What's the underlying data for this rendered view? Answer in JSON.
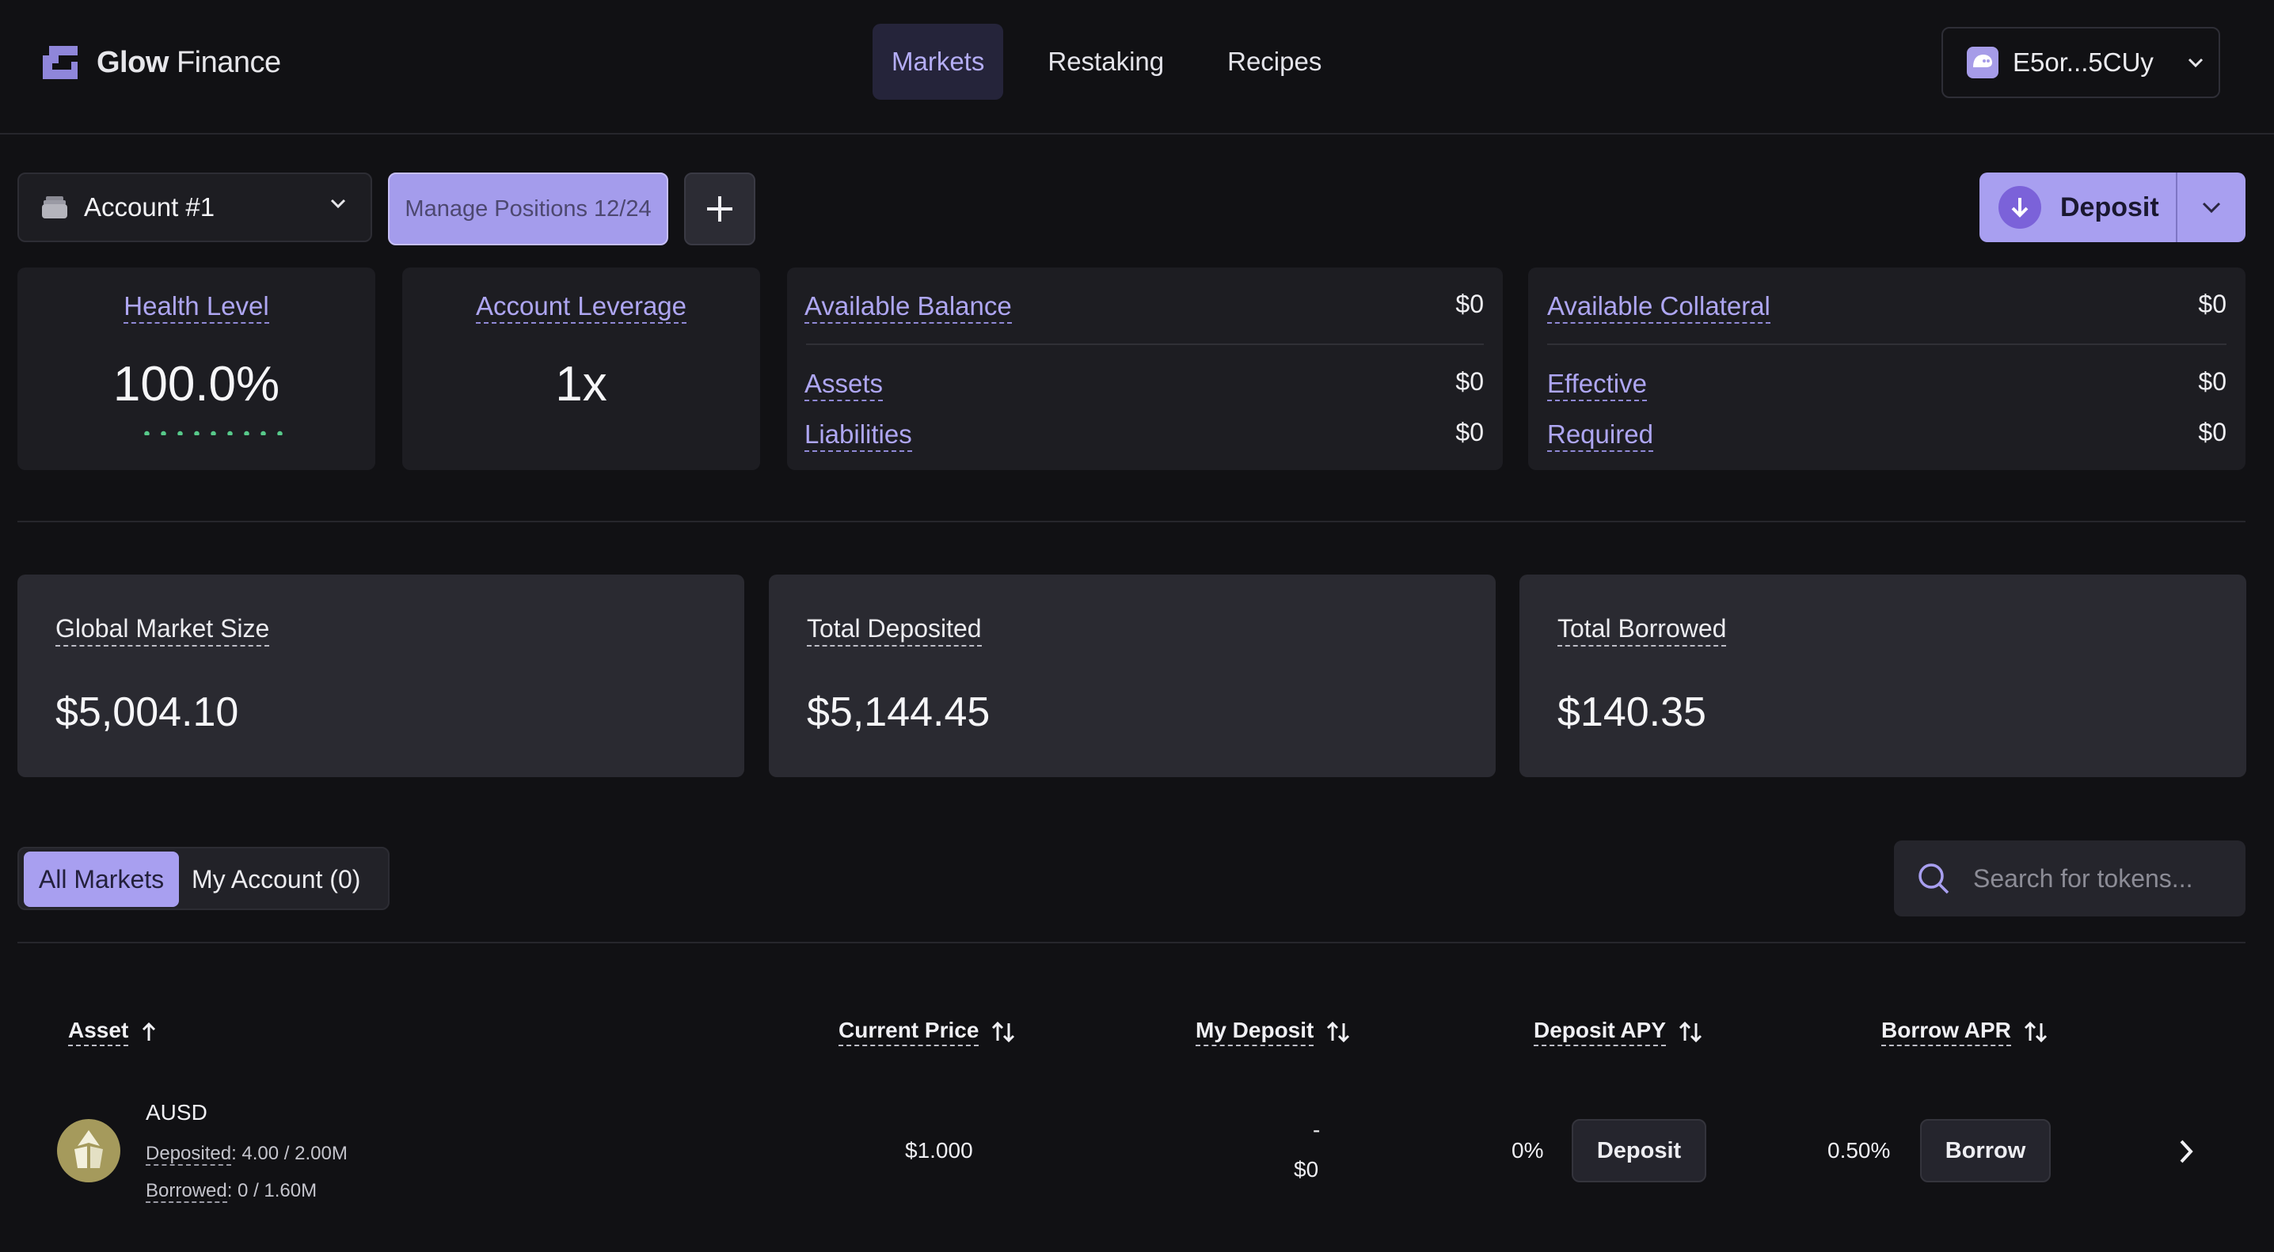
{
  "brand": {
    "name_bold": "Glow",
    "name_rest": " Finance"
  },
  "nav": [
    {
      "label": "Markets",
      "active": true
    },
    {
      "label": "Restaking",
      "active": false
    },
    {
      "label": "Recipes",
      "active": false
    }
  ],
  "wallet": {
    "address": "E5or...5CUy"
  },
  "account": {
    "selected": "Account #1",
    "manage_label": "Manage Positions 12/24",
    "deposit_label": "Deposit"
  },
  "stats": {
    "health": {
      "label": "Health Level",
      "value": "100.0%",
      "level": 1.0
    },
    "leverage": {
      "label": "Account Leverage",
      "value": "1x"
    },
    "balance": {
      "label": "Available Balance",
      "value": "$0",
      "assets_label": "Assets",
      "assets_value": "$0",
      "liabilities_label": "Liabilities",
      "liabilities_value": "$0"
    },
    "collateral": {
      "label": "Available Collateral",
      "value": "$0",
      "effective_label": "Effective",
      "effective_value": "$0",
      "required_label": "Required",
      "required_value": "$0"
    }
  },
  "global": [
    {
      "label": "Global Market Size",
      "value": "$5,004.10"
    },
    {
      "label": "Total Deposited",
      "value": "$5,144.45"
    },
    {
      "label": "Total Borrowed",
      "value": "$140.35"
    }
  ],
  "tabs": {
    "all": "All Markets",
    "mine": "My Account (0)"
  },
  "search": {
    "placeholder": "Search for tokens..."
  },
  "table": {
    "headers": {
      "asset": "Asset",
      "price": "Current Price",
      "my_deposit": "My Deposit",
      "deposit_apy": "Deposit APY",
      "borrow_apr": "Borrow APR"
    },
    "rows": [
      {
        "asset": "AUSD",
        "deposited_label": "Deposited",
        "deposited_value": ": 4.00 / 2.00M",
        "borrowed_label": "Borrowed",
        "borrowed_value": ": 0 / 1.60M",
        "price": "$1.000",
        "my_deposit_amount": "-",
        "my_deposit_usd": "$0",
        "deposit_apy": "0%",
        "deposit_action": "Deposit",
        "borrow_apr": "0.50%",
        "borrow_action": "Borrow"
      }
    ]
  },
  "colors": {
    "accent": "#a89ff0",
    "health": "#57c98a",
    "background": "#111114"
  }
}
